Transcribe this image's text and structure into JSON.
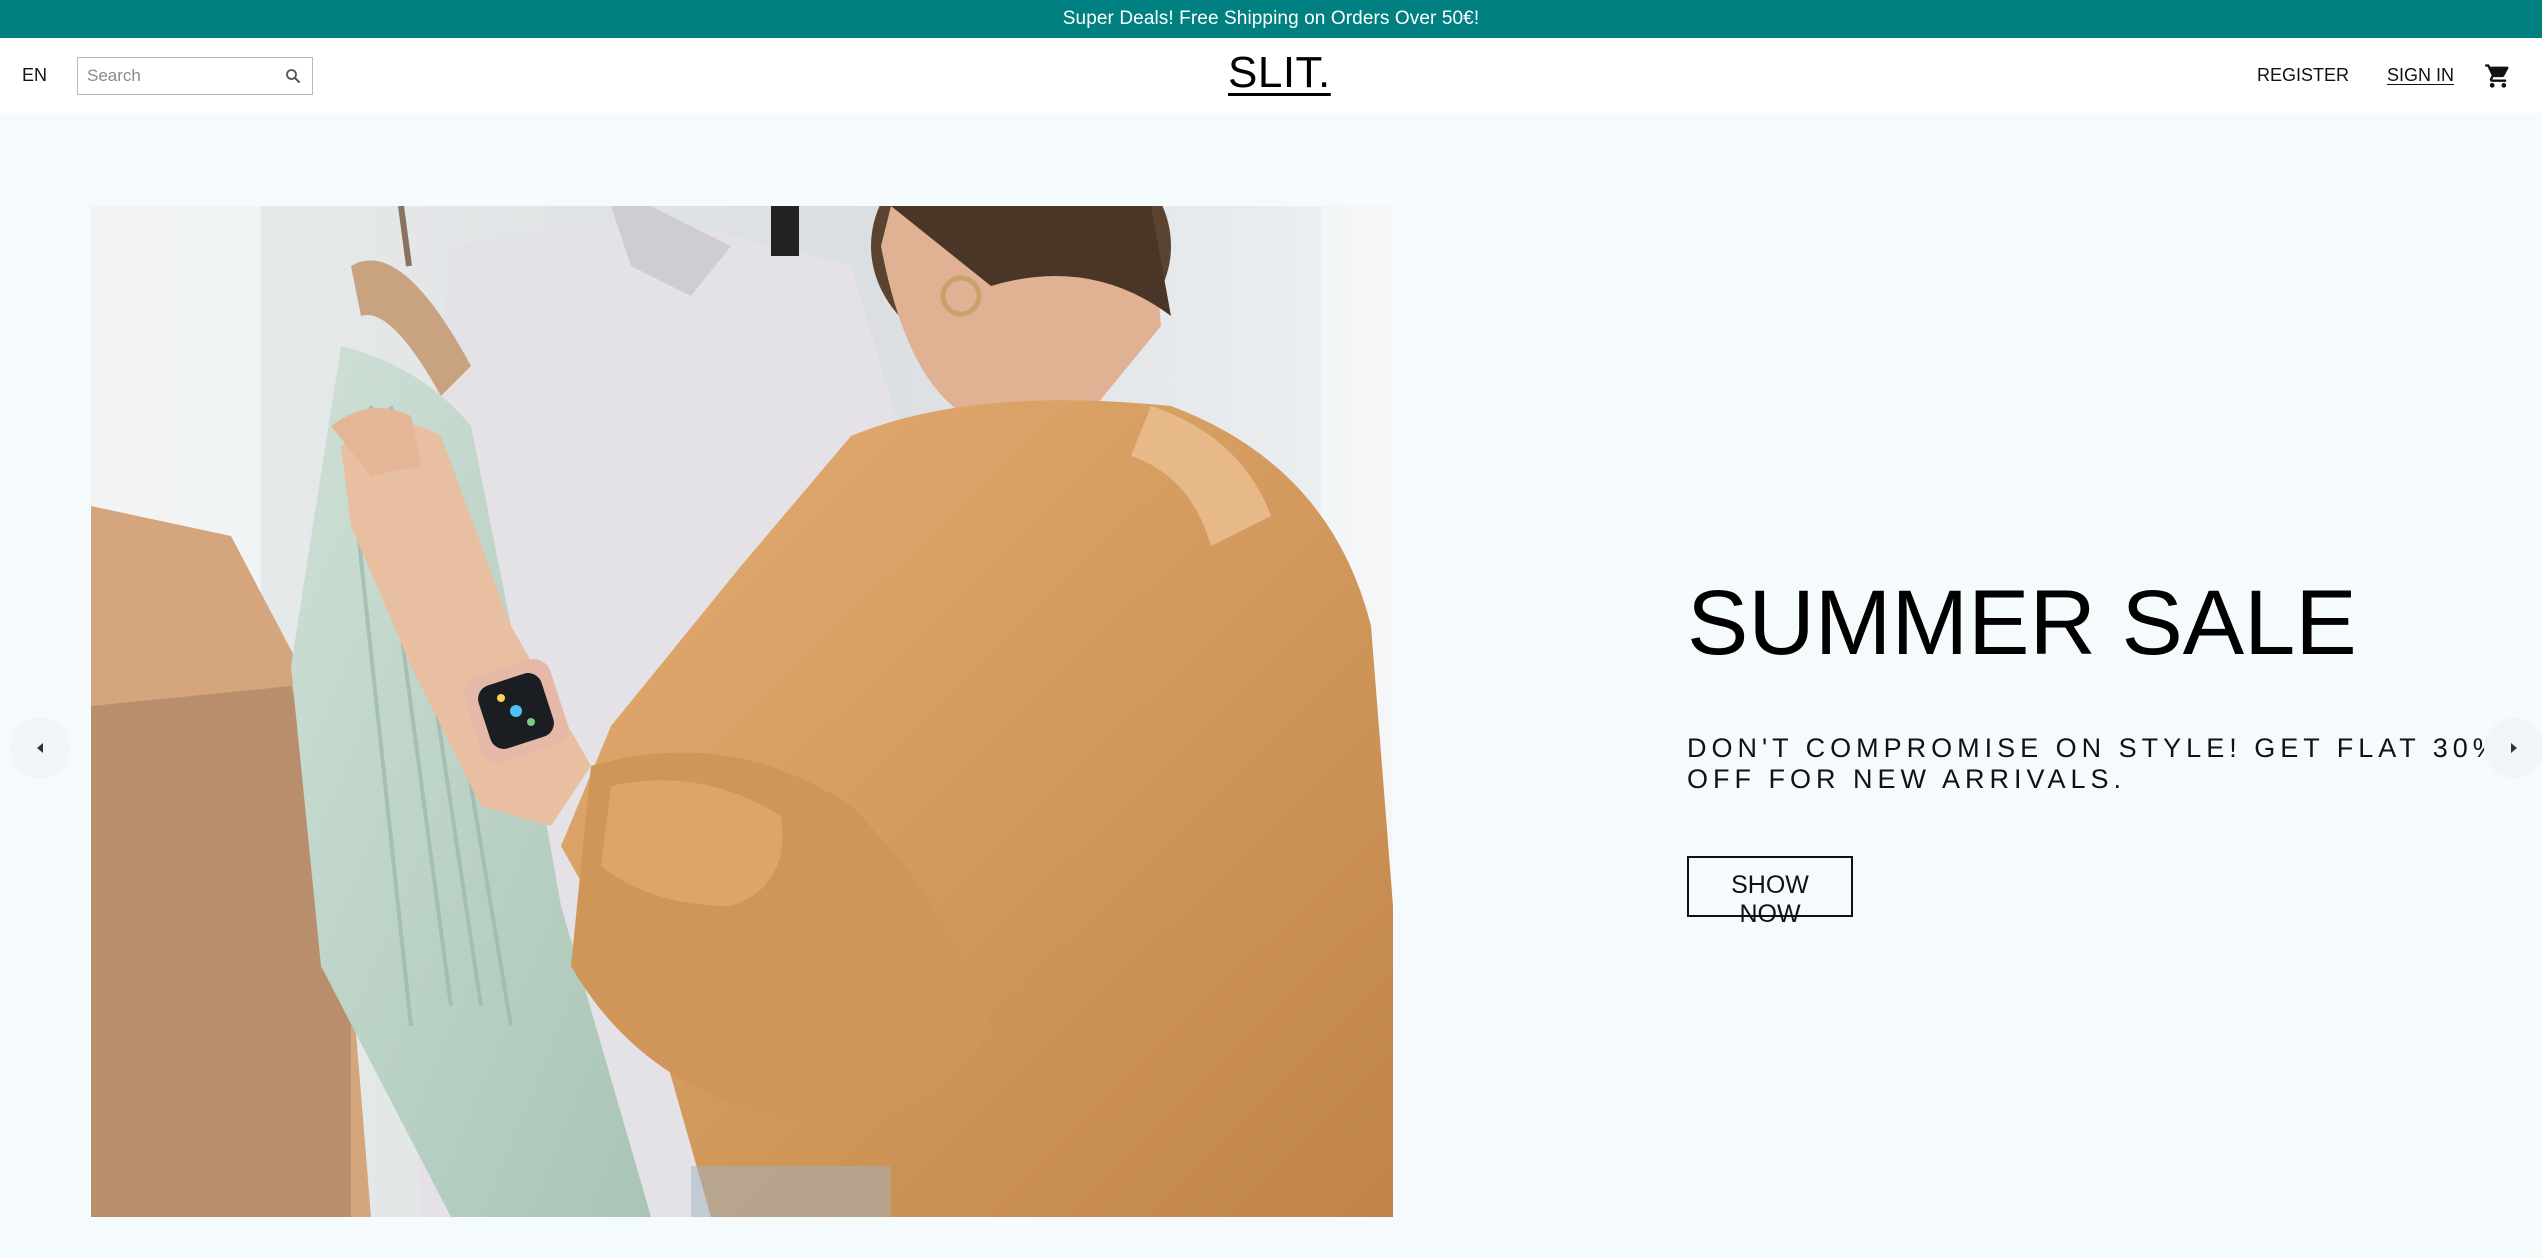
{
  "announcement": {
    "text": "Super Deals! Free Shipping on Orders Over 50€!"
  },
  "header": {
    "language": "EN",
    "search": {
      "placeholder": "Search",
      "value": ""
    },
    "logo": "SLIT.",
    "links": {
      "register": "REGISTER",
      "sign_in": "SIGN IN"
    }
  },
  "slider": {
    "title": "SUMMER SALE",
    "description": "DON'T COMPROMISE ON STYLE! GET FLAT 30% OFF FOR NEW ARRIVALS.",
    "button_label": "SHOW NOW"
  },
  "colors": {
    "accent": "#008080",
    "page_bg": "#f5fafd",
    "header_bg": "#ffffff",
    "text": "#111111"
  },
  "icons": {
    "search": "search-icon",
    "cart": "shopping-cart-icon",
    "prev": "arrow-left-icon",
    "next": "arrow-right-icon"
  }
}
